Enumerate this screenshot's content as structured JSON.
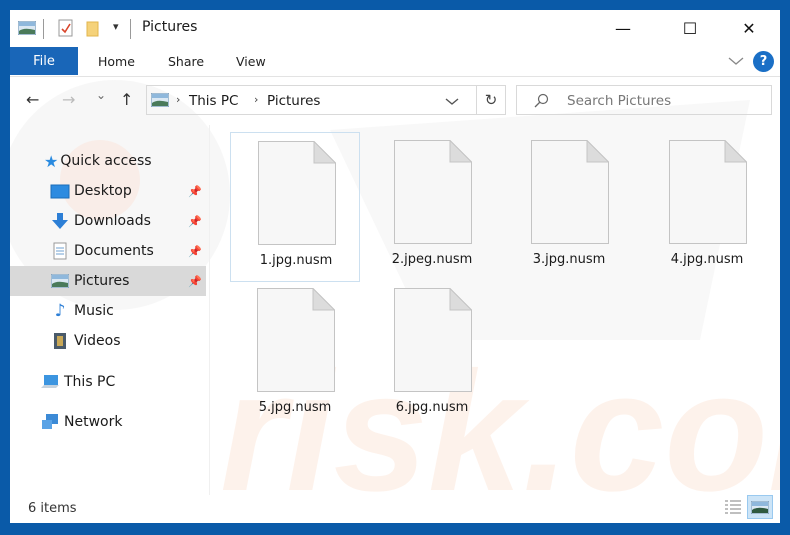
{
  "window": {
    "title": "Pictures",
    "controls": {
      "minimize": "—",
      "maximize": "☐",
      "close": "✕"
    }
  },
  "ribbon": {
    "tabs": [
      {
        "label": "File",
        "active": true
      },
      {
        "label": "Home"
      },
      {
        "label": "Share"
      },
      {
        "label": "View"
      }
    ],
    "help_label": "?",
    "accent_color": "#1966b8"
  },
  "navigation": {
    "back": "←",
    "forward": "→",
    "recent": "⌄",
    "up": "↑",
    "breadcrumb": [
      "This PC",
      "Pictures"
    ],
    "refresh": "↻",
    "search_placeholder": "Search Pictures"
  },
  "sidebar": {
    "quick_access": {
      "label": "Quick access"
    },
    "items": [
      {
        "label": "Desktop",
        "icon": "desktop-icon",
        "pinned": true
      },
      {
        "label": "Downloads",
        "icon": "download-icon",
        "pinned": true
      },
      {
        "label": "Documents",
        "icon": "document-icon",
        "pinned": true
      },
      {
        "label": "Pictures",
        "icon": "pictures-icon",
        "pinned": true,
        "selected": true
      },
      {
        "label": "Music",
        "icon": "music-icon",
        "pinned": false
      },
      {
        "label": "Videos",
        "icon": "video-icon",
        "pinned": false
      }
    ],
    "this_pc": {
      "label": "This PC"
    },
    "network": {
      "label": "Network"
    }
  },
  "files": [
    {
      "name": "1.jpg.nusm",
      "selected": true
    },
    {
      "name": "2.jpeg.nusm"
    },
    {
      "name": "3.jpg.nusm"
    },
    {
      "name": "4.jpg.nusm"
    },
    {
      "name": "5.jpg.nusm"
    },
    {
      "name": "6.jpg.nusm"
    }
  ],
  "status": {
    "item_count": "6 items",
    "view_modes": [
      "details",
      "large-icons"
    ],
    "active_view": "large-icons"
  }
}
